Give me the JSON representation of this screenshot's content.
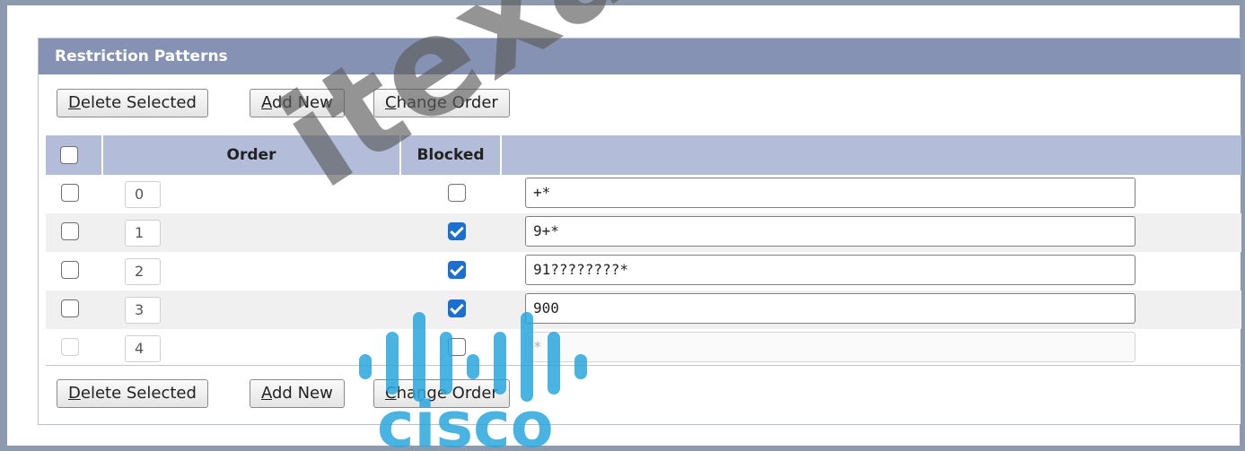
{
  "panel": {
    "title": "Restriction Patterns"
  },
  "toolbar": {
    "delete_selected": {
      "mnemonic": "D",
      "rest": "elete Selected"
    },
    "add_new": {
      "mnemonic": "A",
      "rest": "dd New"
    },
    "change_order": {
      "mnemonic": "C",
      "rest": "hange Order"
    }
  },
  "table": {
    "headers": {
      "order": "Order",
      "blocked": "Blocked",
      "pattern": ""
    },
    "rows": [
      {
        "order": "0",
        "selected": false,
        "blocked": false,
        "pattern": "+*",
        "enabled": true
      },
      {
        "order": "1",
        "selected": false,
        "blocked": true,
        "pattern": "9+*",
        "enabled": true
      },
      {
        "order": "2",
        "selected": false,
        "blocked": true,
        "pattern": "91????????*",
        "enabled": true
      },
      {
        "order": "3",
        "selected": false,
        "blocked": true,
        "pattern": "900",
        "enabled": true
      },
      {
        "order": "4",
        "selected": false,
        "blocked": false,
        "pattern": "*",
        "enabled": false
      }
    ]
  },
  "watermark": {
    "text": "itexampdf.com",
    "logo_text": "cisco"
  },
  "colors": {
    "frame": "#8d9aad",
    "panel_header": "#8592b3",
    "table_header": "#b3bcd9",
    "checkbox_checked": "#1a6fd0",
    "watermark_logo": "#2aa6dd"
  }
}
